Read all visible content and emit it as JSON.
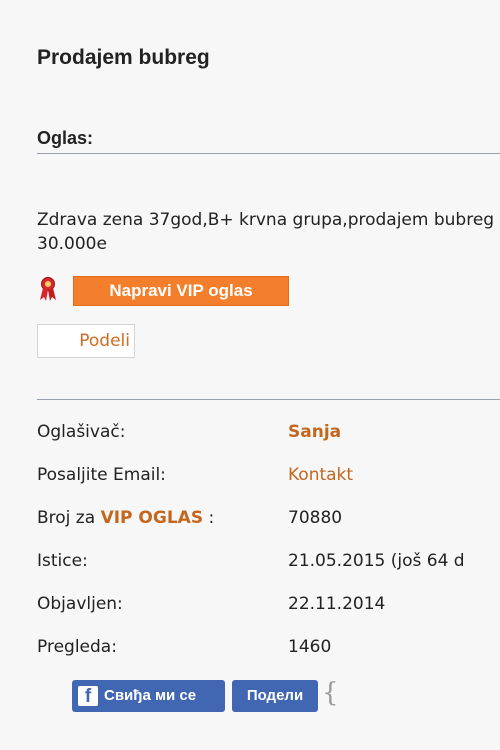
{
  "page": {
    "title": "Prodajem bubreg"
  },
  "ad_section": {
    "heading": "Oglas:",
    "text_line1": "Zdrava zena 37god,B+ krvna grupa,prodajem bubreg",
    "text_line2": "30.000e"
  },
  "actions": {
    "award_icon": "award-ribbon-icon",
    "vip_button_label": "Napravi VIP oglas",
    "share_label": "Podeli"
  },
  "details": {
    "seller_label": "Oglašivač:",
    "seller_value": "Sanja",
    "email_label": "Posaljite Email:",
    "email_value": "Kontakt",
    "vip_number_label_prefix": "Broj za ",
    "vip_number_label_highlight": "VIP OGLAS",
    "vip_number_label_suffix": " :",
    "vip_number_value": "70880",
    "expires_label": "Istice:",
    "expires_value": "21.05.2015 (još 64 d",
    "published_label": "Objavljen:",
    "published_value": "22.11.2014",
    "views_label": "Pregleda:",
    "views_value": "1460"
  },
  "facebook": {
    "logo": "f",
    "like_label": "Свиђа ми се",
    "share_label": "Подели",
    "count_brace": "{"
  },
  "colors": {
    "accent_orange": "#f37f2c",
    "link_orange": "#c4661e",
    "facebook_blue": "#4267b2",
    "divider": "#9a9fae",
    "background": "#f7f7f7"
  }
}
